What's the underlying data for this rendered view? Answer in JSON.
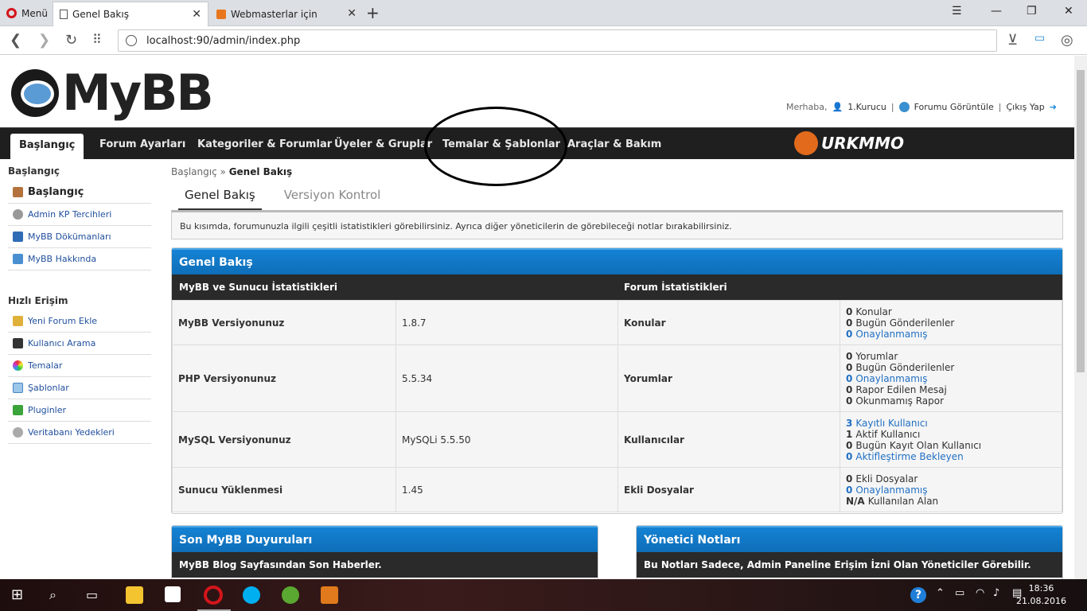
{
  "browser": {
    "menu_label": "Menü",
    "tabs": [
      {
        "title": "Genel Bakış",
        "active": true
      },
      {
        "title": "Webmasterlar için",
        "active": false
      }
    ],
    "url": "localhost:90/admin/index.php"
  },
  "header": {
    "logo_text": "MyBB",
    "welcome_prefix": "Merhaba,",
    "username": "1.Kurucu",
    "view_forum": "Forumu Görüntüle",
    "logout": "Çıkış Yap",
    "separator": "|"
  },
  "mainnav": {
    "tabs": [
      {
        "label": "Başlangıç",
        "active": true
      },
      {
        "label": "Forum Ayarları"
      },
      {
        "label": "Kategoriler & Forumlar"
      },
      {
        "label": "Üyeler & Gruplar"
      },
      {
        "label": "Temalar & Şablonlar"
      },
      {
        "label": "Araçlar & Bakım"
      }
    ],
    "brand": "URKMMO"
  },
  "sidebar": {
    "section1_title": "Başlangıç",
    "section1_items": [
      {
        "label": "Başlangıç",
        "icon": "home-icon"
      },
      {
        "label": "Admin KP Tercihleri",
        "icon": "gear-icon"
      },
      {
        "label": "MyBB Dökümanları",
        "icon": "book-icon"
      },
      {
        "label": "MyBB Hakkında",
        "icon": "info-icon"
      }
    ],
    "section2_title": "Hızlı Erişim",
    "section2_items": [
      {
        "label": "Yeni Forum Ekle",
        "icon": "add-forum-icon"
      },
      {
        "label": "Kullanıcı Arama",
        "icon": "binoculars-icon"
      },
      {
        "label": "Temalar",
        "icon": "palette-icon"
      },
      {
        "label": "Şablonlar",
        "icon": "template-icon"
      },
      {
        "label": "Pluginler",
        "icon": "puzzle-icon"
      },
      {
        "label": "Veritabanı Yedekleri",
        "icon": "database-icon"
      }
    ]
  },
  "content": {
    "breadcrumb_root": "Başlangıç",
    "breadcrumb_sep": "»",
    "breadcrumb_current": "Genel Bakış",
    "tabs": [
      "Genel Bakış",
      "Versiyon Kontrol"
    ],
    "intro": "Bu kısımda, forumunuzla ilgili çeşitli istatistikleri görebilirsiniz. Ayrıca diğer yöneticilerin de görebileceği notlar bırakabilirsiniz.",
    "overview": {
      "title": "Genel Bakış",
      "left_header": "MyBB ve Sunucu İstatistikleri",
      "right_header": "Forum İstatistikleri",
      "rows": [
        {
          "label": "MyBB Versiyonunuz",
          "value": "1.8.7",
          "stat": "Konular",
          "lines": [
            {
              "n": "0",
              "t": "Konular",
              "link": false
            },
            {
              "n": "0",
              "t": "Bugün Gönderilenler",
              "link": false
            },
            {
              "n": "0",
              "t": "Onaylanmamış",
              "link": true
            }
          ]
        },
        {
          "label": "PHP Versiyonunuz",
          "value": "5.5.34",
          "stat": "Yorumlar",
          "lines": [
            {
              "n": "0",
              "t": "Yorumlar",
              "link": false
            },
            {
              "n": "0",
              "t": "Bugün Gönderilenler",
              "link": false
            },
            {
              "n": "0",
              "t": "Onaylanmamış",
              "link": true
            },
            {
              "n": "0",
              "t": "Rapor Edilen Mesaj",
              "link": false
            },
            {
              "n": "0",
              "t": "Okunmamış Rapor",
              "link": false
            }
          ]
        },
        {
          "label": "MySQL Versiyonunuz",
          "value": "MySQLi 5.5.50",
          "stat": "Kullanıcılar",
          "lines": [
            {
              "n": "3",
              "t": "Kayıtlı Kullanıcı",
              "link": true
            },
            {
              "n": "1",
              "t": "Aktif Kullanıcı",
              "link": false
            },
            {
              "n": "0",
              "t": "Bugün Kayıt Olan Kullanıcı",
              "link": false
            },
            {
              "n": "0",
              "t": "Aktifleştirme Bekleyen",
              "link": true
            }
          ]
        },
        {
          "label": "Sunucu Yüklenmesi",
          "value": "1.45",
          "stat": "Ekli Dosyalar",
          "lines": [
            {
              "n": "0",
              "t": "Ekli Dosyalar",
              "link": false
            },
            {
              "n": "0",
              "t": "Onaylanmamış",
              "link": true
            },
            {
              "n": "N/A",
              "t": "Kullanılan Alan",
              "link": false
            }
          ]
        }
      ]
    },
    "news": {
      "title": "Son MyBB Duyuruları",
      "subtitle": "MyBB Blog Sayfasından Son Haberler."
    },
    "notes": {
      "title": "Yönetici Notları",
      "subtitle": "Bu Notları Sadece, Admin Paneline Erişim İzni Olan Yöneticiler Görebilir."
    }
  },
  "taskbar": {
    "time": "18:36",
    "date": "21.08.2016",
    "colors": {
      "opera": "#d4151b",
      "skype": "#00aff0",
      "utorrent": "#5aa832",
      "folder": "#f4c430"
    }
  }
}
